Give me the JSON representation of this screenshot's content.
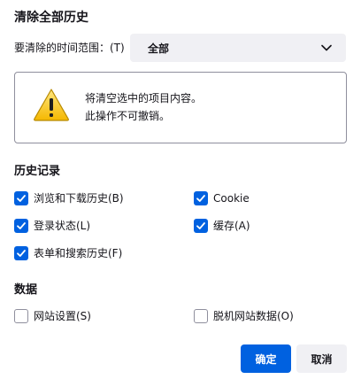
{
  "dialog": {
    "title": "清除全部历史"
  },
  "range": {
    "label": "要清除的时间范围：(T)",
    "selected": "全部"
  },
  "warning": {
    "line1": "将清空选中的项目内容。",
    "line2": "此操作不可撤销。"
  },
  "history": {
    "heading": "历史记录",
    "items": [
      {
        "label": "浏览和下载历史(B)",
        "checked": true
      },
      {
        "label": "Cookie",
        "checked": true
      },
      {
        "label": "登录状态(L)",
        "checked": true
      },
      {
        "label": "缓存(A)",
        "checked": true
      },
      {
        "label": "表单和搜索历史(F)",
        "checked": true
      }
    ]
  },
  "data": {
    "heading": "数据",
    "items": [
      {
        "label": "网站设置(S)",
        "checked": false
      },
      {
        "label": "脱机网站数据(O)",
        "checked": false
      }
    ]
  },
  "buttons": {
    "ok": "确定",
    "cancel": "取消"
  },
  "colors": {
    "accent": "#0061e0",
    "warning": "#ffd24a"
  }
}
